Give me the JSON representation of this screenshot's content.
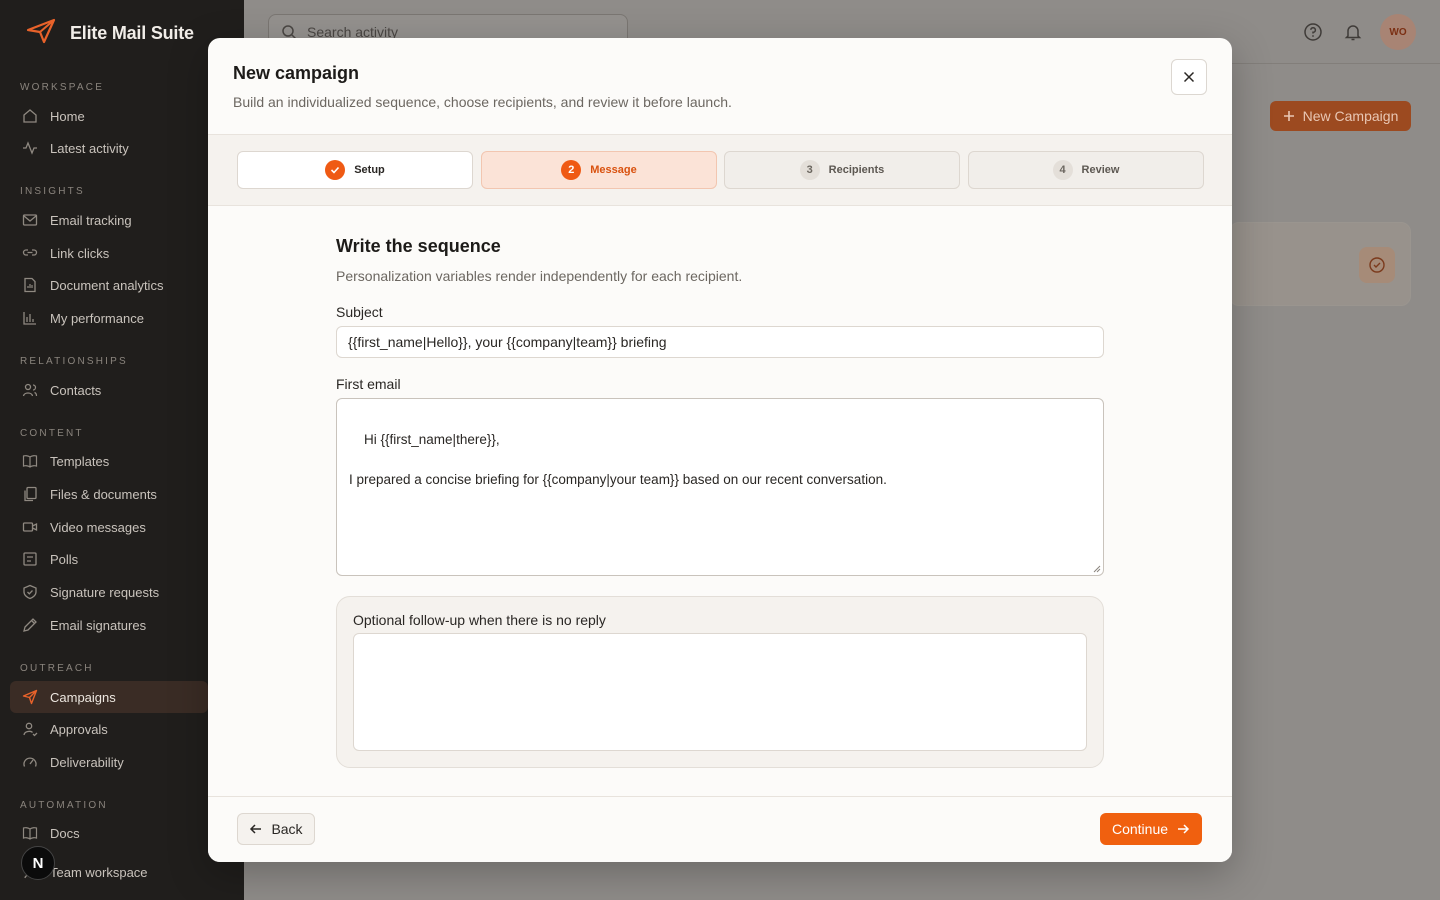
{
  "app": {
    "name": "Elite Mail Suite"
  },
  "sidebar": {
    "sections": [
      {
        "title": "WORKSPACE",
        "items": [
          {
            "label": "Home",
            "icon": "home-icon"
          },
          {
            "label": "Latest activity",
            "icon": "activity-icon"
          }
        ]
      },
      {
        "title": "INSIGHTS",
        "items": [
          {
            "label": "Email tracking",
            "icon": "mail-icon"
          },
          {
            "label": "Link clicks",
            "icon": "link-icon"
          },
          {
            "label": "Document analytics",
            "icon": "document-icon"
          },
          {
            "label": "My performance",
            "icon": "bar-chart-icon"
          }
        ]
      },
      {
        "title": "RELATIONSHIPS",
        "items": [
          {
            "label": "Contacts",
            "icon": "users-icon"
          }
        ]
      },
      {
        "title": "CONTENT",
        "items": [
          {
            "label": "Templates",
            "icon": "book-icon"
          },
          {
            "label": "Files & documents",
            "icon": "files-icon"
          },
          {
            "label": "Video messages",
            "icon": "video-icon"
          },
          {
            "label": "Polls",
            "icon": "poll-icon"
          },
          {
            "label": "Signature requests",
            "icon": "shield-icon"
          },
          {
            "label": "Email signatures",
            "icon": "pen-icon"
          }
        ]
      },
      {
        "title": "OUTREACH",
        "items": [
          {
            "label": "Campaigns",
            "icon": "send-icon",
            "active": true
          },
          {
            "label": "Approvals",
            "icon": "user-check-icon"
          },
          {
            "label": "Deliverability",
            "icon": "gauge-icon"
          }
        ]
      },
      {
        "title": "AUTOMATION",
        "items": [
          {
            "label": "Docs",
            "icon": "book-icon"
          },
          {
            "label": "Team workspace",
            "icon": "team-icon"
          }
        ]
      }
    ],
    "dev_badge": "N"
  },
  "header": {
    "search_placeholder": "Search activity",
    "avatar_initials": "WO",
    "new_campaign_label": "New Campaign"
  },
  "modal": {
    "title": "New campaign",
    "subtitle": "Build an individualized sequence, choose recipients, and review it before launch.",
    "steps": [
      {
        "num": "✓",
        "label": "Setup",
        "state": "done"
      },
      {
        "num": "2",
        "label": "Message",
        "state": "current"
      },
      {
        "num": "3",
        "label": "Recipients",
        "state": "upcoming"
      },
      {
        "num": "4",
        "label": "Review",
        "state": "upcoming"
      }
    ],
    "section_title": "Write the sequence",
    "section_subtitle": "Personalization variables render independently for each recipient.",
    "subject_label": "Subject",
    "subject_value": "{{first_name|Hello}}, your {{company|team}} briefing",
    "first_email_label": "First email",
    "first_email_value": "Hi {{first_name|there}},\n\nI prepared a concise briefing for {{company|your team}} based on our recent conversation.",
    "followup_label": "Optional follow-up when there is no reply",
    "followup_value": "",
    "back_label": "Back",
    "continue_label": "Continue"
  },
  "colors": {
    "accent": "#f0600f",
    "sidebar_bg": "#201e1c"
  }
}
